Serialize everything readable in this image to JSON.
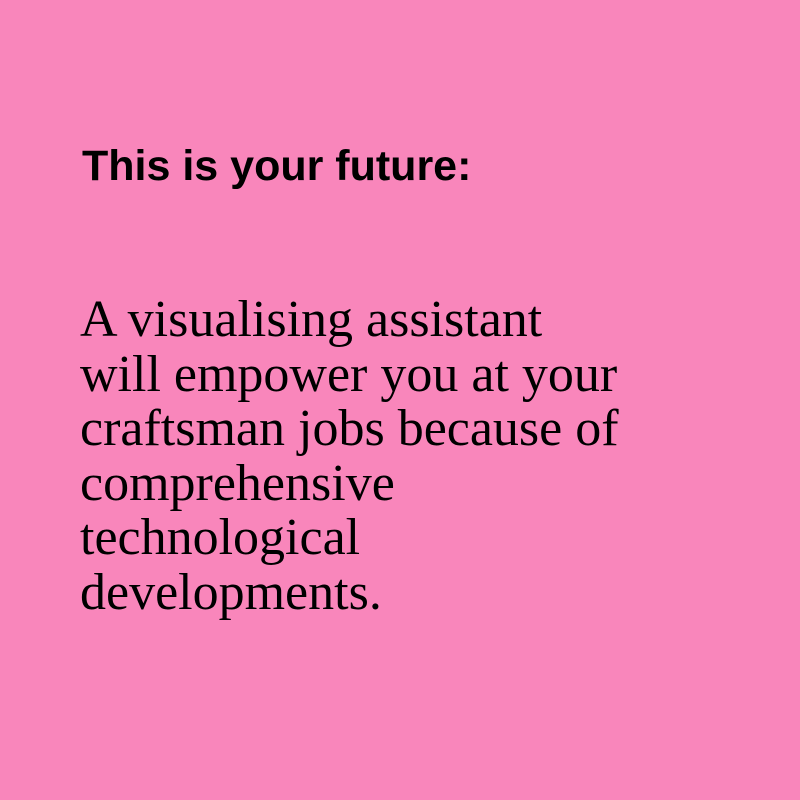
{
  "colors": {
    "background": "#f986bb",
    "text": "#000000"
  },
  "heading": "This is your future:",
  "body_lines": [
    "A visualising assistant",
    "will empower you at your",
    "craftsman jobs because of",
    "comprehensive",
    "technological",
    "developments."
  ]
}
